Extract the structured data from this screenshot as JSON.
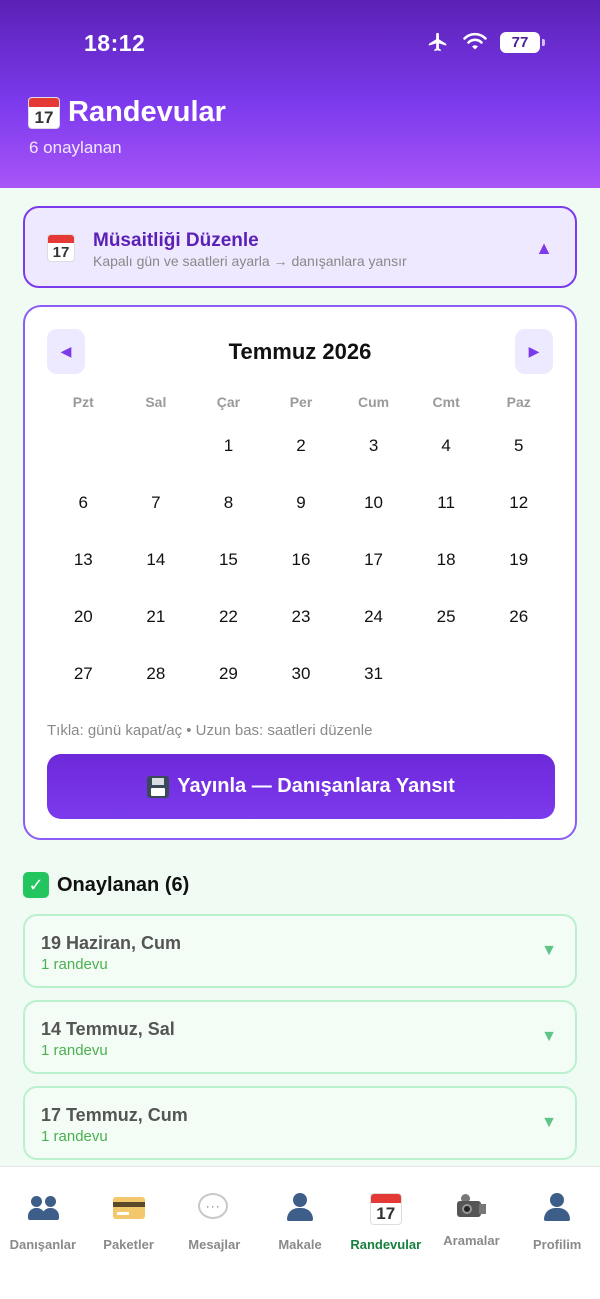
{
  "status_bar": {
    "time": "18:12",
    "battery": "77"
  },
  "header": {
    "title": "Randevular",
    "subtitle": "6 onaylanan",
    "calendar_icon_day": "17"
  },
  "availability": {
    "title": "Müsaitliği Düzenle",
    "subtitle": "Kapalı gün ve saatleri ayarla → danışanlara yansır",
    "icon_day": "17",
    "arrow": "▲"
  },
  "calendar": {
    "prev": "◀",
    "next": "▶",
    "month_title": "Temmuz 2026",
    "weekdays": [
      "Pzt",
      "Sal",
      "Çar",
      "Per",
      "Cum",
      "Cmt",
      "Paz"
    ],
    "days": [
      "",
      "",
      "1",
      "2",
      "3",
      "4",
      "5",
      "6",
      "7",
      "8",
      "9",
      "10",
      "11",
      "12",
      "13",
      "14",
      "15",
      "16",
      "17",
      "18",
      "19",
      "20",
      "21",
      "22",
      "23",
      "24",
      "25",
      "26",
      "27",
      "28",
      "29",
      "30",
      "31",
      "",
      "",
      ""
    ],
    "hint": "Tıkla: günü kapat/aç  •  Uzun bas: saatleri düzenle",
    "publish_label": "Yayınla — Danışanlara Yansıt"
  },
  "approved": {
    "title": "Onaylanan (6)",
    "check": "✓",
    "items": [
      {
        "date": "19 Haziran, Cum",
        "count": "1 randevu",
        "arrow": "▼"
      },
      {
        "date": "14 Temmuz, Sal",
        "count": "1 randevu",
        "arrow": "▼"
      },
      {
        "date": "17 Temmuz, Cum",
        "count": "1 randevu",
        "arrow": "▼"
      }
    ]
  },
  "tabbar": {
    "tabs": [
      {
        "label": "Danışanlar",
        "icon": "users-icon"
      },
      {
        "label": "Paketler",
        "icon": "credit-card-icon"
      },
      {
        "label": "Mesajlar",
        "icon": "chat-bubble-icon"
      },
      {
        "label": "Makale",
        "icon": "user-icon"
      },
      {
        "label": "Randevular",
        "icon": "calendar-icon"
      },
      {
        "label": "Aramalar",
        "icon": "video-camera-icon"
      },
      {
        "label": "Profilim",
        "icon": "user-icon"
      }
    ],
    "active": "Randevular",
    "calendar_icon_day": "17",
    "chat_dots": "···",
    "active_color": "#15803d"
  },
  "colors": {
    "primary": "#7c3aed",
    "success": "#22c55e",
    "background": "#effbf3"
  }
}
